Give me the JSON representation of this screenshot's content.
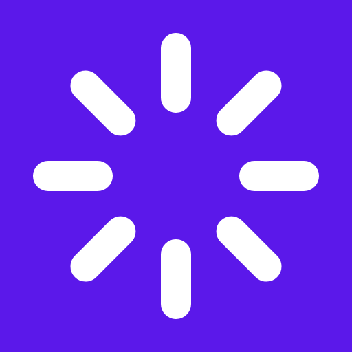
{
  "icon": {
    "name": "loading-spinner-icon",
    "background_color": "#5B18EA",
    "stroke_color": "#FFFFFF",
    "segment_count": 8
  }
}
